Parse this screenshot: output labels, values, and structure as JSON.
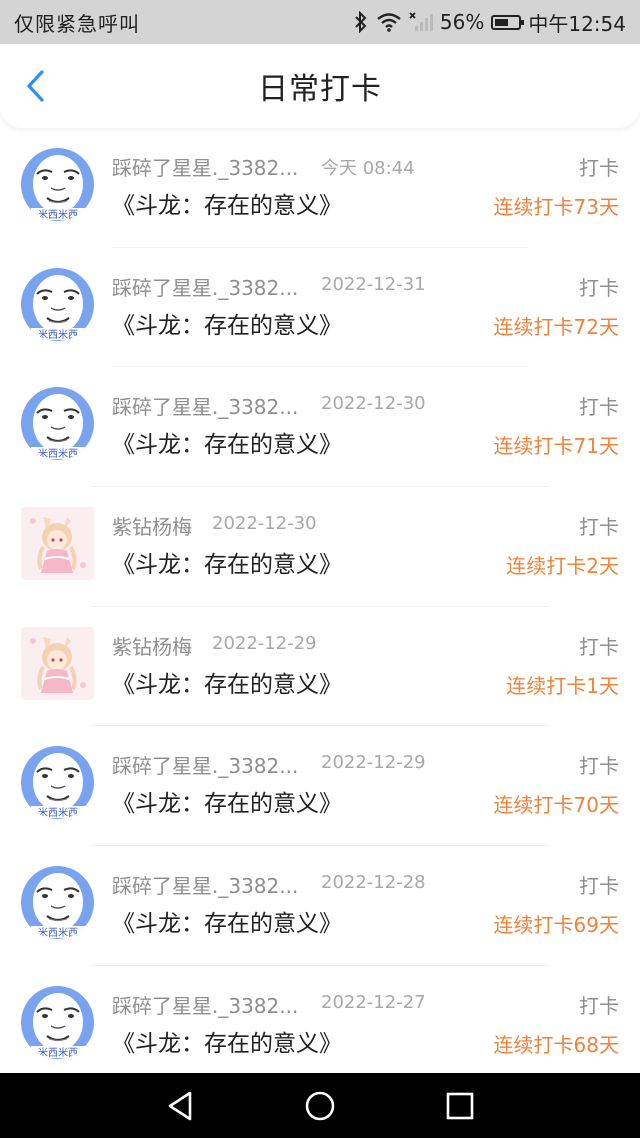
{
  "status_bar": {
    "left_text": "仅限紧急呼叫",
    "battery": "56%",
    "battery_level": 0.56,
    "time": "中午12:54"
  },
  "header": {
    "title": "日常打卡"
  },
  "colors": {
    "accent": "#2f8ff0",
    "streak": "#f2813a",
    "muted": "#8f8f8f"
  },
  "entries": [
    {
      "avatar": "meme-face-avatar",
      "name": "踩碎了星星._3382...",
      "date": "今天 08:44",
      "kind": "打卡",
      "book": "《斗龙：存在的意义》",
      "streak": "连续打卡73天"
    },
    {
      "avatar": "meme-face-avatar",
      "name": "踩碎了星星._3382...",
      "date": "2022-12-31",
      "kind": "打卡",
      "book": "《斗龙：存在的意义》",
      "streak": "连续打卡72天"
    },
    {
      "avatar": "meme-face-avatar",
      "name": "踩碎了星星._3382...",
      "date": "2022-12-30",
      "kind": "打卡",
      "book": "《斗龙：存在的意义》",
      "streak": "连续打卡71天"
    },
    {
      "avatar": "anime-girl-avatar",
      "name": "紫钻杨梅",
      "date": "2022-12-30",
      "kind": "打卡",
      "book": "《斗龙：存在的意义》",
      "streak": "连续打卡2天"
    },
    {
      "avatar": "anime-girl-avatar",
      "name": "紫钻杨梅",
      "date": "2022-12-29",
      "kind": "打卡",
      "book": "《斗龙：存在的意义》",
      "streak": "连续打卡1天"
    },
    {
      "avatar": "meme-face-avatar",
      "name": "踩碎了星星._3382...",
      "date": "2022-12-29",
      "kind": "打卡",
      "book": "《斗龙：存在的意义》",
      "streak": "连续打卡70天"
    },
    {
      "avatar": "meme-face-avatar",
      "name": "踩碎了星星._3382...",
      "date": "2022-12-28",
      "kind": "打卡",
      "book": "《斗龙：存在的意义》",
      "streak": "连续打卡69天"
    },
    {
      "avatar": "meme-face-avatar",
      "name": "踩碎了星星._3382...",
      "date": "2022-12-27",
      "kind": "打卡",
      "book": "《斗龙：存在的意义》",
      "streak": "连续打卡68天"
    }
  ],
  "avatar_texts": {
    "meme": "米西米西"
  },
  "nav": {
    "back": "back-triangle-icon",
    "home": "home-circle-icon",
    "recents": "recents-square-icon"
  }
}
